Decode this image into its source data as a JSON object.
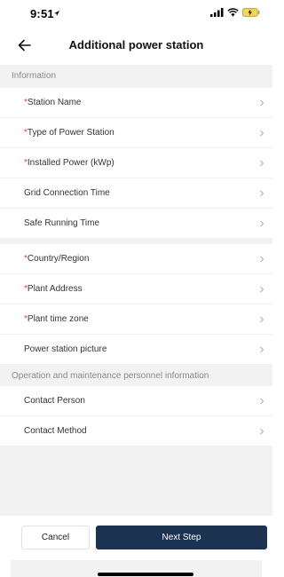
{
  "status": {
    "time": "9:51",
    "location_icon": "location-arrow-icon",
    "signal_icon": "cellular-signal-icon",
    "wifi_icon": "wifi-icon",
    "battery_icon": "battery-charging-icon"
  },
  "header": {
    "back_icon": "arrow-left-icon",
    "title": "Additional power station"
  },
  "sections": {
    "information": "Information",
    "personnel": "Operation and maintenance personnel information"
  },
  "required_mark": "*",
  "rows": {
    "station_name": "Station Name",
    "type_of_station": "Type of Power Station",
    "installed_power": "Installed Power (kWp)",
    "grid_connection_time": "Grid Connection Time",
    "safe_running_time": "Safe Running Time",
    "country_region": "Country/Region",
    "plant_address": "Plant Address",
    "plant_time_zone": "Plant time zone",
    "power_station_picture": "Power station picture",
    "contact_person": "Contact Person",
    "contact_method": "Contact Method"
  },
  "footer": {
    "cancel_label": "Cancel",
    "next_label": "Next Step"
  },
  "colors": {
    "primary": "#1b3350",
    "required": "#e23b3b",
    "section_bg": "#f2f2f2"
  }
}
